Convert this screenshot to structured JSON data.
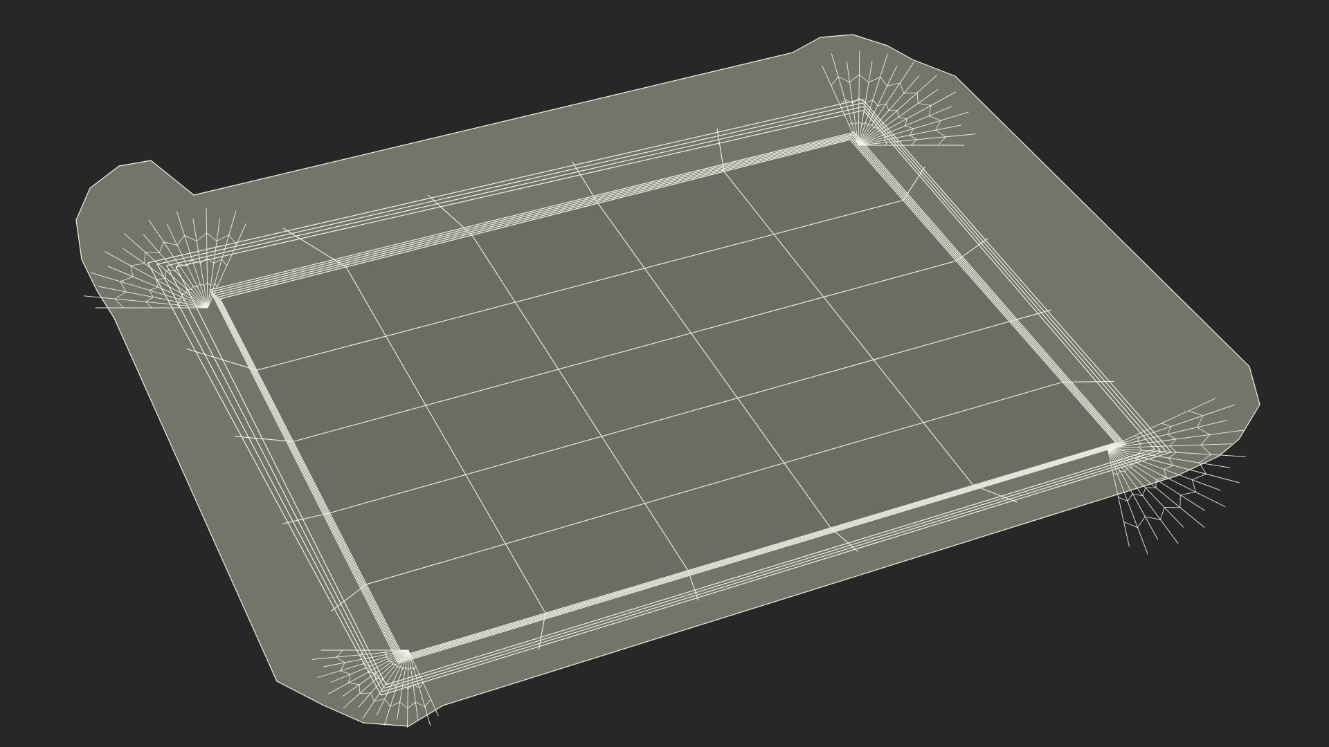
{
  "scene": {
    "subject": "tray-wireframe",
    "colors": {
      "background": "#272727",
      "surface": "#75746b",
      "surface_shade": "#6d6c64",
      "wire": "#f3f2e6"
    }
  }
}
